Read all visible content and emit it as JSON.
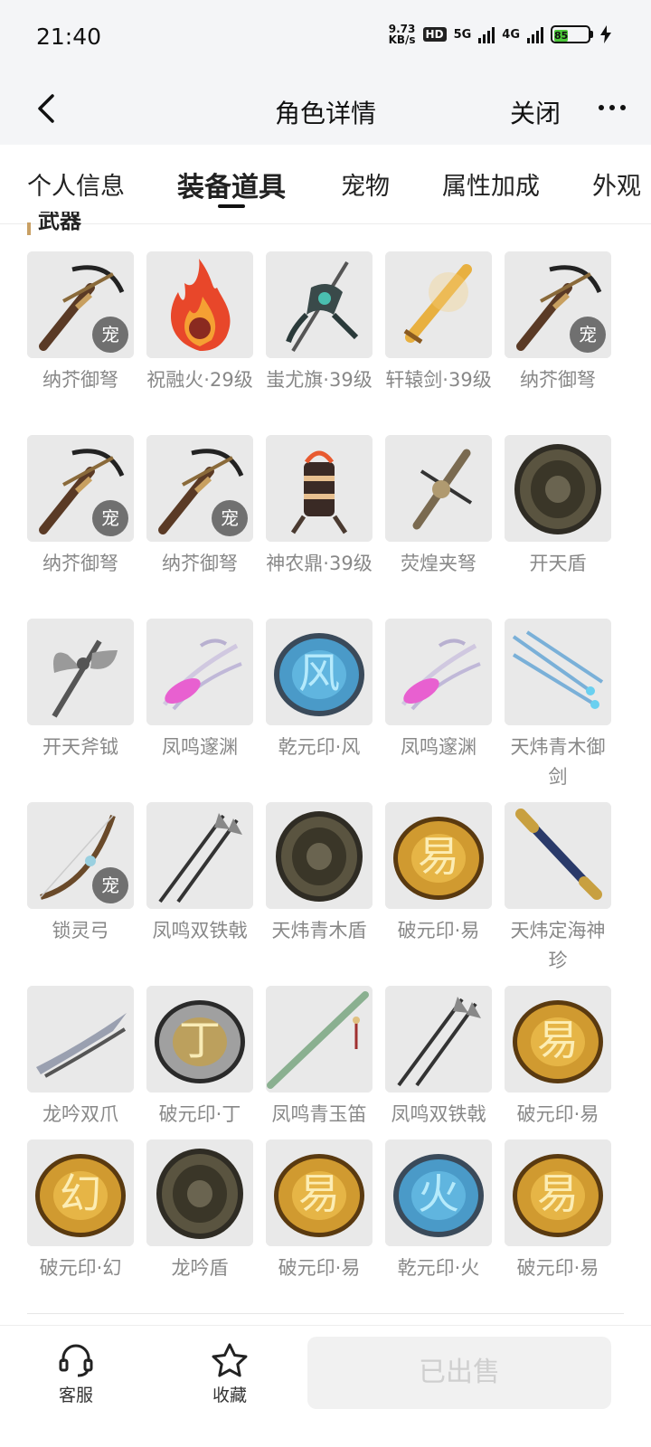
{
  "status_bar": {
    "time": "21:40",
    "net_speed_value": "9.73",
    "net_speed_unit": "KB/s",
    "hd_badge": "HD",
    "signal_1": "5G",
    "signal_2": "4G",
    "battery": "85",
    "battery_level": 0.85
  },
  "header": {
    "title": "角色详情",
    "close_label": "关闭"
  },
  "tabs": [
    {
      "label": "个人信息",
      "active": false
    },
    {
      "label": "装备道具",
      "active": true
    },
    {
      "label": "宠物",
      "active": false
    },
    {
      "label": "属性加成",
      "active": false
    },
    {
      "label": "外观",
      "active": false
    }
  ],
  "section": {
    "title": "武器"
  },
  "pet_badge": "宠",
  "items": [
    {
      "label": "纳芥御弩",
      "pet": true,
      "icon": "crossbow-icon"
    },
    {
      "label": "祝融火·29级",
      "pet": false,
      "icon": "fire-icon"
    },
    {
      "label": "蚩尤旗·39级",
      "pet": false,
      "icon": "banner-icon"
    },
    {
      "label": "轩辕剑·39级",
      "pet": false,
      "icon": "sword-icon"
    },
    {
      "label": "纳芥御弩",
      "pet": true,
      "icon": "crossbow-icon"
    },
    {
      "label": "纳芥御弩",
      "pet": true,
      "icon": "crossbow-icon"
    },
    {
      "label": "纳芥御弩",
      "pet": true,
      "icon": "crossbow-icon"
    },
    {
      "label": "神农鼎·39级",
      "pet": false,
      "icon": "cauldron-icon"
    },
    {
      "label": "荧煌夹弩",
      "pet": false,
      "icon": "crossbow-gold-icon"
    },
    {
      "label": "开天盾",
      "pet": false,
      "icon": "shield-icon"
    },
    {
      "label": "开天斧钺",
      "pet": false,
      "icon": "axe-icon"
    },
    {
      "label": "凤鸣邃渊",
      "pet": false,
      "icon": "claw-pink-icon"
    },
    {
      "label": "乾元印·风",
      "pet": false,
      "icon": "seal-blue-icon"
    },
    {
      "label": "凤鸣邃渊",
      "pet": false,
      "icon": "claw-pink-icon"
    },
    {
      "label": "天炜青木御剑",
      "pet": false,
      "icon": "flying-swords-icon"
    },
    {
      "label": "锁灵弓",
      "pet": true,
      "icon": "bow-icon"
    },
    {
      "label": "凤鸣双铁戟",
      "pet": false,
      "icon": "halberd-icon"
    },
    {
      "label": "天炜青木盾",
      "pet": false,
      "icon": "shield-icon"
    },
    {
      "label": "破元印·易",
      "pet": false,
      "icon": "seal-gold-icon"
    },
    {
      "label": "天炜定海神珍",
      "pet": false,
      "icon": "staff-icon"
    },
    {
      "label": "龙吟双爪",
      "pet": false,
      "icon": "blades-icon"
    },
    {
      "label": "破元印·丁",
      "pet": false,
      "icon": "seal-silver-icon"
    },
    {
      "label": "凤鸣青玉笛",
      "pet": false,
      "icon": "flute-icon"
    },
    {
      "label": "凤鸣双铁戟",
      "pet": false,
      "icon": "halberd-icon"
    },
    {
      "label": "破元印·易",
      "pet": false,
      "icon": "seal-gold-icon"
    },
    {
      "label": "破元印·幻",
      "pet": false,
      "icon": "seal-gold-icon"
    },
    {
      "label": "龙吟盾",
      "pet": false,
      "icon": "shield-icon"
    },
    {
      "label": "破元印·易",
      "pet": false,
      "icon": "seal-gold-icon"
    },
    {
      "label": "乾元印·火",
      "pet": false,
      "icon": "seal-blue-icon"
    },
    {
      "label": "破元印·易",
      "pet": false,
      "icon": "seal-gold-icon"
    }
  ],
  "seal_glyphs": {
    "乾元印·风": "风",
    "乾元印·火": "火",
    "破元印·丁": "丁",
    "破元印·易": "易",
    "破元印·幻": "幻"
  },
  "bottom_bar": {
    "service_label": "客服",
    "favorite_label": "收藏",
    "sold_label": "已出售"
  }
}
